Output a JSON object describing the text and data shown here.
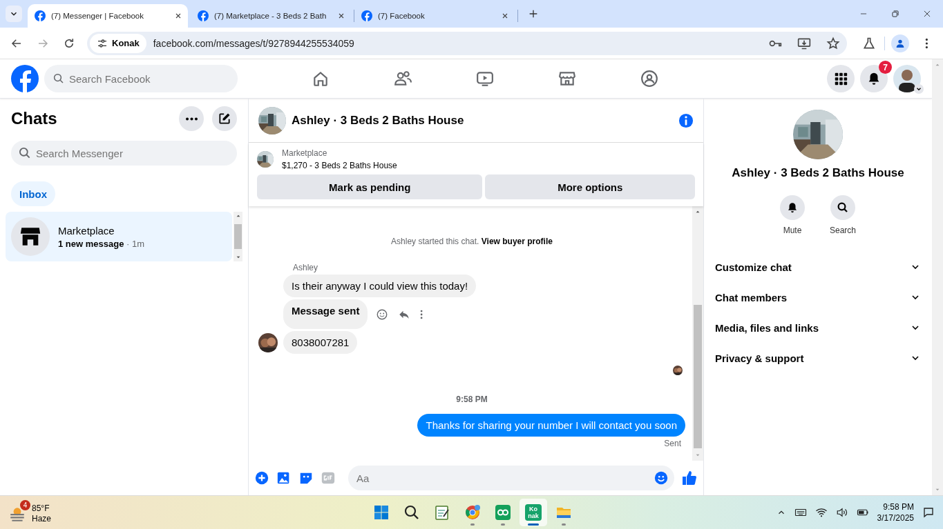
{
  "browser": {
    "tabs": [
      {
        "title": "(7) Messenger | Facebook",
        "selected": true
      },
      {
        "title": "(7) Marketplace - 3 Beds 2 Bath",
        "selected": false
      },
      {
        "title": "(7) Facebook",
        "selected": false
      }
    ],
    "address": {
      "chip": "Konak",
      "url": "facebook.com/messages/t/9278944255534059"
    }
  },
  "fb_header": {
    "search_placeholder": "Search Facebook",
    "nav": [
      {
        "kind": "home"
      },
      {
        "kind": "friends"
      },
      {
        "kind": "video"
      },
      {
        "kind": "store"
      },
      {
        "kind": "groups"
      }
    ],
    "notification_count": "7"
  },
  "chats": {
    "title": "Chats",
    "search_placeholder": "Search Messenger",
    "filters": [
      {
        "label": "Inbox",
        "selected": true
      }
    ],
    "items": [
      {
        "name": "Marketplace",
        "preview": "1 new message",
        "time": "· 1m",
        "selected": true
      }
    ]
  },
  "conversation": {
    "title": "Ashley · 3 Beds 2 Baths House",
    "listing": {
      "source": "Marketplace",
      "title": "$1,270 - 3 Beds 2 Baths House"
    },
    "buttons": [
      "Mark as pending",
      "More options"
    ],
    "notice": "Ashley started this chat.",
    "notice_link": "View buyer profile",
    "messages": [
      {
        "kind": "sender",
        "text": "Ashley"
      },
      {
        "kind": "incoming",
        "text": "Is their anyway I could view this today!",
        "hovered": false,
        "avatar": false
      },
      {
        "kind": "status",
        "text": "Message sent",
        "hovered": true,
        "avatar": false
      },
      {
        "kind": "incoming",
        "text": "8038007281",
        "hovered": false,
        "avatar": true
      },
      {
        "kind": "seen"
      },
      {
        "kind": "time",
        "text": "9:58 PM"
      },
      {
        "kind": "outgoing",
        "text": "Thanks for sharing your number I will contact you soon"
      },
      {
        "kind": "receipt",
        "text": "Sent"
      }
    ],
    "composer_placeholder": "Aa"
  },
  "details": {
    "title": "Ashley · 3 Beds 2 Baths House",
    "actions": [
      {
        "kind": "bell",
        "label": "Mute"
      },
      {
        "kind": "search",
        "label": "Search"
      }
    ],
    "sections": [
      {
        "label": "Customize chat",
        "expanded": false
      },
      {
        "label": "Chat members",
        "expanded": false
      },
      {
        "label": "Media, files and links",
        "expanded": false
      },
      {
        "label": "Privacy & support",
        "expanded": false
      }
    ]
  },
  "taskbar": {
    "weather": {
      "badge": "4",
      "temp": "85°F",
      "condition": "Haze"
    },
    "apps": [
      {
        "kind": "start",
        "running": false,
        "active": false
      },
      {
        "kind": "search",
        "running": false,
        "active": false
      },
      {
        "kind": "notepad",
        "running": false,
        "active": false
      },
      {
        "kind": "chrome",
        "running": true,
        "active": false
      },
      {
        "kind": "green",
        "running": true,
        "active": false
      },
      {
        "kind": "konak",
        "label": "Konak",
        "running": true,
        "active": true
      },
      {
        "kind": "folder",
        "running": true,
        "active": false
      }
    ],
    "time": "9:58 PM",
    "date": "3/17/2025"
  }
}
